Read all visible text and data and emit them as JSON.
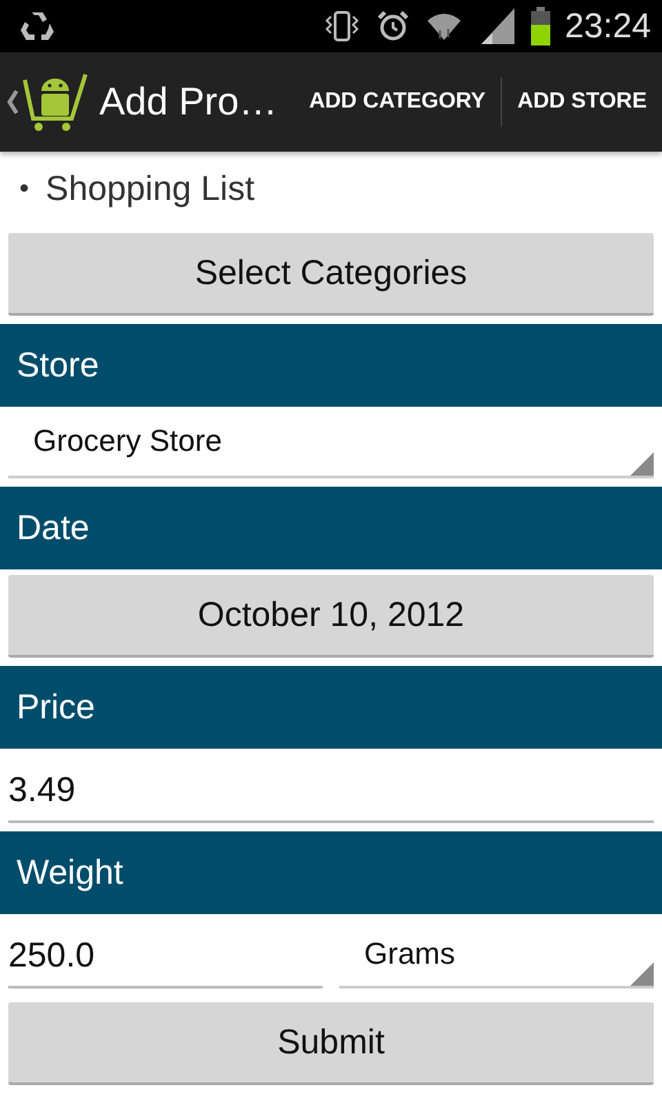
{
  "status_bar": {
    "time": "23:24"
  },
  "action_bar": {
    "title": "Add Pro…",
    "actions": [
      "ADD CATEGORY",
      "ADD STORE"
    ]
  },
  "form": [
    {
      "kind": "bullet",
      "bullet": "•",
      "text": "Shopping List"
    },
    {
      "kind": "button",
      "label": "Select Categories"
    },
    {
      "kind": "header",
      "text": "Store"
    },
    {
      "kind": "spinner",
      "value": "Grocery Store"
    },
    {
      "kind": "header",
      "text": "Date"
    },
    {
      "kind": "button",
      "label": "October 10, 2012"
    },
    {
      "kind": "header",
      "text": "Price"
    },
    {
      "kind": "input",
      "value": "3.49"
    },
    {
      "kind": "header",
      "text": "Weight"
    },
    {
      "kind": "input-spinner",
      "value": "250.0",
      "unit": "Grams"
    },
    {
      "kind": "button",
      "label": "Submit"
    }
  ]
}
